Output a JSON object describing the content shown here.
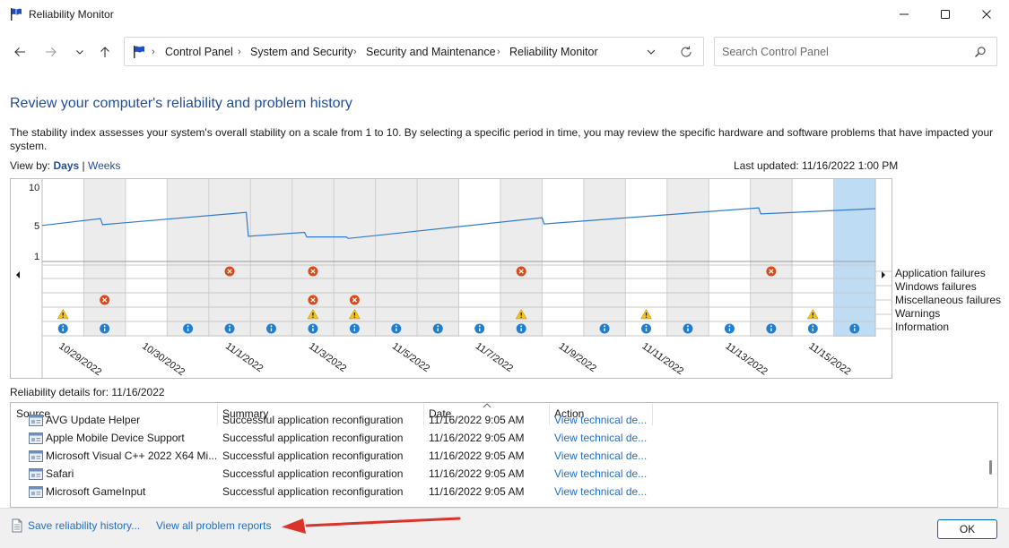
{
  "window": {
    "title": "Reliability Monitor",
    "icon": "flag-icon",
    "controls": [
      "minimize-icon",
      "maximize-icon",
      "close-icon"
    ]
  },
  "nav": {
    "breadcrumb": [
      "Control Panel",
      "System and Security",
      "Security and Maintenance",
      "Reliability Monitor"
    ],
    "search_placeholder": "Search Control Panel"
  },
  "main": {
    "heading": "Review your computer's reliability and problem history",
    "description": "The stability index assesses your system's overall stability on a scale from 1 to 10. By selecting a specific period in time, you may review the specific hardware and software problems that have impacted your system.",
    "view_by_label": "View by:",
    "view_days": "Days",
    "view_sep": "|",
    "view_weeks": "Weeks",
    "last_updated": "Last updated: 11/16/2022 1:00 PM",
    "details_label": "Reliability details for: 11/16/2022"
  },
  "chart": {
    "y_ticks": [
      "10",
      "5",
      "1"
    ],
    "legend": [
      "Application failures",
      "Windows failures",
      "Miscellaneous failures",
      "Warnings",
      "Information"
    ],
    "date_labels": [
      "10/29/2022",
      "10/30/2022",
      "11/1/2022",
      "11/3/2022",
      "11/5/2022",
      "11/7/2022",
      "11/9/2022",
      "11/11/2022",
      "11/13/2022",
      "11/15/2022"
    ],
    "line_color": "#2e7bcf",
    "selected_color": "#bfdcf5"
  },
  "chart_data": {
    "type": "line",
    "title": "",
    "xlabel": "",
    "ylabel": "",
    "ylim": [
      1,
      10
    ],
    "days": 20,
    "stability_index": [
      [
        0,
        5.0
      ],
      [
        1.4,
        5.9
      ],
      [
        1.45,
        5.1
      ],
      [
        4.9,
        6.7
      ],
      [
        4.95,
        3.6
      ],
      [
        6.3,
        4.1
      ],
      [
        6.35,
        3.5
      ],
      [
        7.3,
        3.5
      ],
      [
        7.35,
        3.3
      ],
      [
        12.0,
        6.0
      ],
      [
        12.05,
        5.2
      ],
      [
        17.2,
        7.3
      ],
      [
        17.25,
        6.5
      ],
      [
        20.0,
        7.2
      ]
    ],
    "events": {
      "application_failures": [
        4,
        6,
        11,
        17
      ],
      "windows_failures": [],
      "miscellaneous_failures": [
        1,
        6,
        7
      ],
      "warnings": [
        0,
        6,
        7,
        11,
        14,
        18
      ],
      "information": [
        0,
        1,
        3,
        4,
        5,
        6,
        7,
        8,
        9,
        10,
        11,
        13,
        14,
        15,
        16,
        17,
        18,
        19
      ]
    },
    "selected_day": 19
  },
  "table": {
    "columns": [
      "Source",
      "Summary",
      "Date",
      "Action"
    ],
    "rows": [
      {
        "source": "AVG Update Helper",
        "summary": "Successful application reconfiguration",
        "date": "11/16/2022 9:05 AM",
        "action": "View technical de..."
      },
      {
        "source": "Apple Mobile Device Support",
        "summary": "Successful application reconfiguration",
        "date": "11/16/2022 9:05 AM",
        "action": "View technical de..."
      },
      {
        "source": "Microsoft Visual C++ 2022 X64 Mi...",
        "summary": "Successful application reconfiguration",
        "date": "11/16/2022 9:05 AM",
        "action": "View technical de..."
      },
      {
        "source": "Safari",
        "summary": "Successful application reconfiguration",
        "date": "11/16/2022 9:05 AM",
        "action": "View technical de..."
      },
      {
        "source": "Microsoft GameInput",
        "summary": "Successful application reconfiguration",
        "date": "11/16/2022 9:05 AM",
        "action": "View technical de..."
      }
    ]
  },
  "footer": {
    "save_history": "Save reliability history...",
    "view_all": "View all problem reports",
    "ok": "OK"
  }
}
